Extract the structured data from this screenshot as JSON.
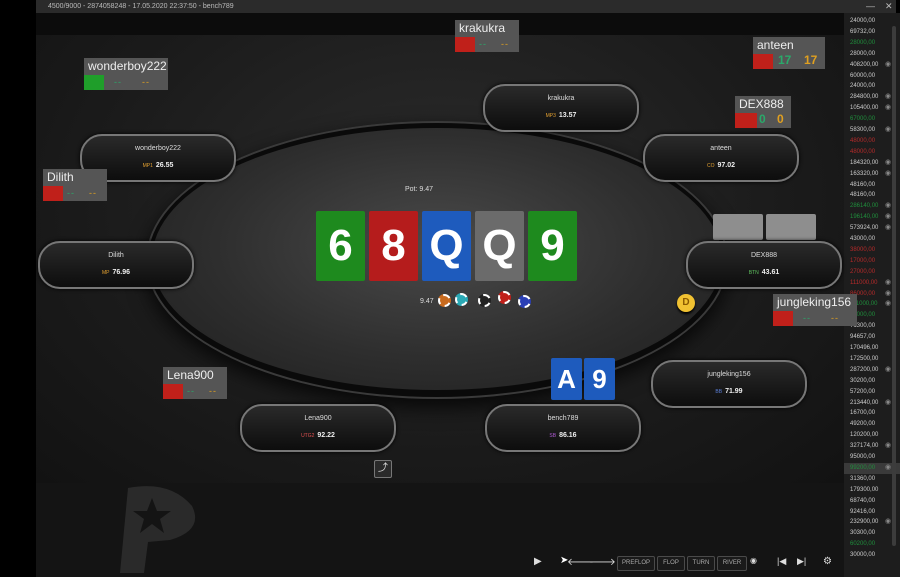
{
  "window": {
    "title": "4500/9000 - 2874058248 - 17.05.2020 22:37:50 - bench789",
    "minimize": "—",
    "close": "✕"
  },
  "pot": {
    "label": "Pot:",
    "value": "9.47",
    "chips_amount": "9.47"
  },
  "board": [
    {
      "rank": "6",
      "color": "#1e8a1e"
    },
    {
      "rank": "8",
      "color": "#b51c1c"
    },
    {
      "rank": "Q",
      "color": "#1e5bbd"
    },
    {
      "rank": "Q",
      "color": "#6b6b6b"
    },
    {
      "rank": "9",
      "color": "#1e8a1e"
    }
  ],
  "hero_cards": [
    {
      "rank": "A",
      "color": "#1e5bbd"
    },
    {
      "rank": "9",
      "color": "#1e5bbd"
    }
  ],
  "seats": [
    {
      "name": "krakukra",
      "position": "MP3",
      "stack": "13.57"
    },
    {
      "name": "wonderboy222",
      "position": "MP1",
      "stack": "26.55"
    },
    {
      "name": "anteen",
      "position": "CO",
      "stack": "97.02"
    },
    {
      "name": "Dilith",
      "position": "MP",
      "stack": "76.96"
    },
    {
      "name": "DEX888",
      "position": "BTN",
      "stack": "43.61"
    },
    {
      "name": "jungleking156",
      "position": "BB",
      "stack": "71.99"
    },
    {
      "name": "Lena900",
      "position": "UTG2",
      "stack": "92.22"
    },
    {
      "name": "bench789",
      "position": "SB",
      "stack": "86.16"
    }
  ],
  "tags": {
    "krakukra": {
      "name": "krakukra",
      "swatch": "#c0201a",
      "v1": "--",
      "v2": "--"
    },
    "anteen": {
      "name": "anteen",
      "swatch": "#c0201a",
      "v1": "17",
      "v2": "17"
    },
    "wonderboy222": {
      "name": "wonderboy222",
      "swatch": "#1f9e2a",
      "v1": "--",
      "v2": "--"
    },
    "DEX888": {
      "name": "DEX888",
      "swatch": "#c0201a",
      "v1": "0",
      "v2": "0"
    },
    "Dilith": {
      "name": "Dilith",
      "swatch": "#c0201a",
      "v1": "--",
      "v2": "--"
    },
    "jungleking156": {
      "name": "jungleking156",
      "swatch": "#c0201a",
      "v1": "--",
      "v2": "--"
    },
    "Lena900": {
      "name": "Lena900",
      "swatch": "#c0201a",
      "v1": "--",
      "v2": "--"
    }
  },
  "dealer_button": "D",
  "replay_controls": {
    "play": "▶",
    "back": "🡐",
    "forward": "🡒",
    "preflop": "PREFLOP",
    "flop": "FLOP",
    "turn": "TURN",
    "river": "RIVER",
    "first": "|◀",
    "last": "▶|",
    "settings": "⚙"
  },
  "sidebar": [
    {
      "v": "24000,00",
      "c": "#cccccc",
      "eye": ""
    },
    {
      "v": "69732,00",
      "c": "#cccccc",
      "eye": ""
    },
    {
      "v": "28000,00",
      "c": "#1f8f3c",
      "eye": ""
    },
    {
      "v": "28000,00",
      "c": "#cccccc",
      "eye": ""
    },
    {
      "v": "408200,00",
      "c": "#cccccc",
      "eye": "👁"
    },
    {
      "v": "60000,00",
      "c": "#cccccc",
      "eye": ""
    },
    {
      "v": "24000,00",
      "c": "#cccccc",
      "eye": ""
    },
    {
      "v": "284800,00",
      "c": "#cccccc",
      "eye": "👁"
    },
    {
      "v": "105400,00",
      "c": "#cccccc",
      "eye": "👁"
    },
    {
      "v": "67000,00",
      "c": "#1f8f3c",
      "eye": ""
    },
    {
      "v": "58300,00",
      "c": "#cccccc",
      "eye": "👁"
    },
    {
      "v": "48000,00",
      "c": "#b52a2a",
      "eye": ""
    },
    {
      "v": "48000,00",
      "c": "#b52a2a",
      "eye": ""
    },
    {
      "v": "184320,00",
      "c": "#cccccc",
      "eye": "👁"
    },
    {
      "v": "163320,00",
      "c": "#cccccc",
      "eye": "👁"
    },
    {
      "v": "48160,00",
      "c": "#cccccc",
      "eye": ""
    },
    {
      "v": "48160,00",
      "c": "#cccccc",
      "eye": ""
    },
    {
      "v": "286140,00",
      "c": "#1f8f3c",
      "eye": "👁"
    },
    {
      "v": "196140,00",
      "c": "#1f8f3c",
      "eye": "👁"
    },
    {
      "v": "573924,00",
      "c": "#cccccc",
      "eye": "👁"
    },
    {
      "v": "43000,00",
      "c": "#cccccc",
      "eye": ""
    },
    {
      "v": "38000,00",
      "c": "#b52a2a",
      "eye": ""
    },
    {
      "v": "17000,00",
      "c": "#b52a2a",
      "eye": ""
    },
    {
      "v": "27000,00",
      "c": "#b52a2a",
      "eye": ""
    },
    {
      "v": "111000,00",
      "c": "#b52a2a",
      "eye": "👁"
    },
    {
      "v": "86000,00",
      "c": "#b52a2a",
      "eye": "👁"
    },
    {
      "v": "111000,00",
      "c": "#1f8f3c",
      "eye": "👁"
    },
    {
      "v": "64000,00",
      "c": "#1f8f3c",
      "eye": ""
    },
    {
      "v": "71300,00",
      "c": "#cccccc",
      "eye": ""
    },
    {
      "v": "94657,00",
      "c": "#cccccc",
      "eye": ""
    },
    {
      "v": "170496,00",
      "c": "#cccccc",
      "eye": ""
    },
    {
      "v": "172500,00",
      "c": "#cccccc",
      "eye": ""
    },
    {
      "v": "287200,00",
      "c": "#cccccc",
      "eye": "👁"
    },
    {
      "v": "30200,00",
      "c": "#cccccc",
      "eye": ""
    },
    {
      "v": "57200,00",
      "c": "#cccccc",
      "eye": ""
    },
    {
      "v": "213440,00",
      "c": "#cccccc",
      "eye": "👁"
    },
    {
      "v": "16700,00",
      "c": "#cccccc",
      "eye": ""
    },
    {
      "v": "49200,00",
      "c": "#cccccc",
      "eye": ""
    },
    {
      "v": "120200,00",
      "c": "#cccccc",
      "eye": ""
    },
    {
      "v": "327174,00",
      "c": "#cccccc",
      "eye": "👁"
    },
    {
      "v": "95000,00",
      "c": "#cccccc",
      "eye": ""
    },
    {
      "v": "99200,00",
      "c": "#1f8f3c",
      "eye": "👁",
      "sel": true
    },
    {
      "v": "31360,00",
      "c": "#cccccc",
      "eye": ""
    },
    {
      "v": "179300,00",
      "c": "#cccccc",
      "eye": ""
    },
    {
      "v": "68740,00",
      "c": "#cccccc",
      "eye": ""
    },
    {
      "v": "92416,00",
      "c": "#cccccc",
      "eye": ""
    },
    {
      "v": "232900,00",
      "c": "#cccccc",
      "eye": "👁"
    },
    {
      "v": "30300,00",
      "c": "#cccccc",
      "eye": ""
    },
    {
      "v": "60200,00",
      "c": "#1f8f3c",
      "eye": ""
    },
    {
      "v": "30000,00",
      "c": "#cccccc",
      "eye": ""
    }
  ]
}
